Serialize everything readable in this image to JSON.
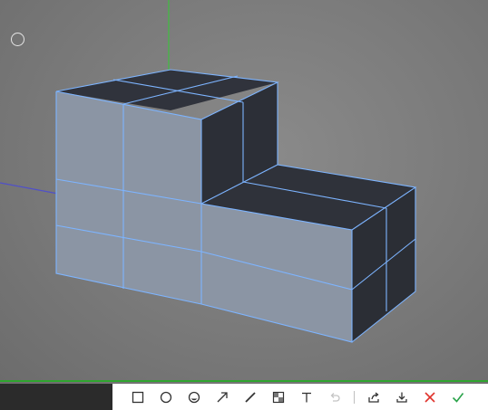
{
  "viewport": {
    "background": "#7a7a7a",
    "edge_color": "#7db4ff",
    "axis_colors": {
      "y": "#3fbf3f",
      "x": "#5050c8"
    }
  },
  "hud": {
    "icon": "circle-icon"
  },
  "toolbar": {
    "background": "#ffffff",
    "tools": [
      {
        "name": "rectangle-tool",
        "icon": "square-outline-icon"
      },
      {
        "name": "ellipse-tool",
        "icon": "circle-outline-icon"
      },
      {
        "name": "marker-tool",
        "icon": "marker-icon"
      },
      {
        "name": "arrow-tool",
        "icon": "arrow-up-right-icon"
      },
      {
        "name": "pen-tool",
        "icon": "pen-icon"
      },
      {
        "name": "mosaic-tool",
        "icon": "mosaic-icon"
      },
      {
        "name": "text-tool",
        "icon": "text-T-icon"
      },
      {
        "name": "undo-button",
        "icon": "undo-icon",
        "disabled": true
      },
      {
        "name": "share-button",
        "icon": "share-icon"
      },
      {
        "name": "download-button",
        "icon": "download-icon"
      },
      {
        "name": "cancel-button",
        "icon": "close-icon",
        "color": "#e0322b"
      },
      {
        "name": "confirm-button",
        "icon": "check-icon",
        "color": "#2aa34a"
      }
    ]
  }
}
